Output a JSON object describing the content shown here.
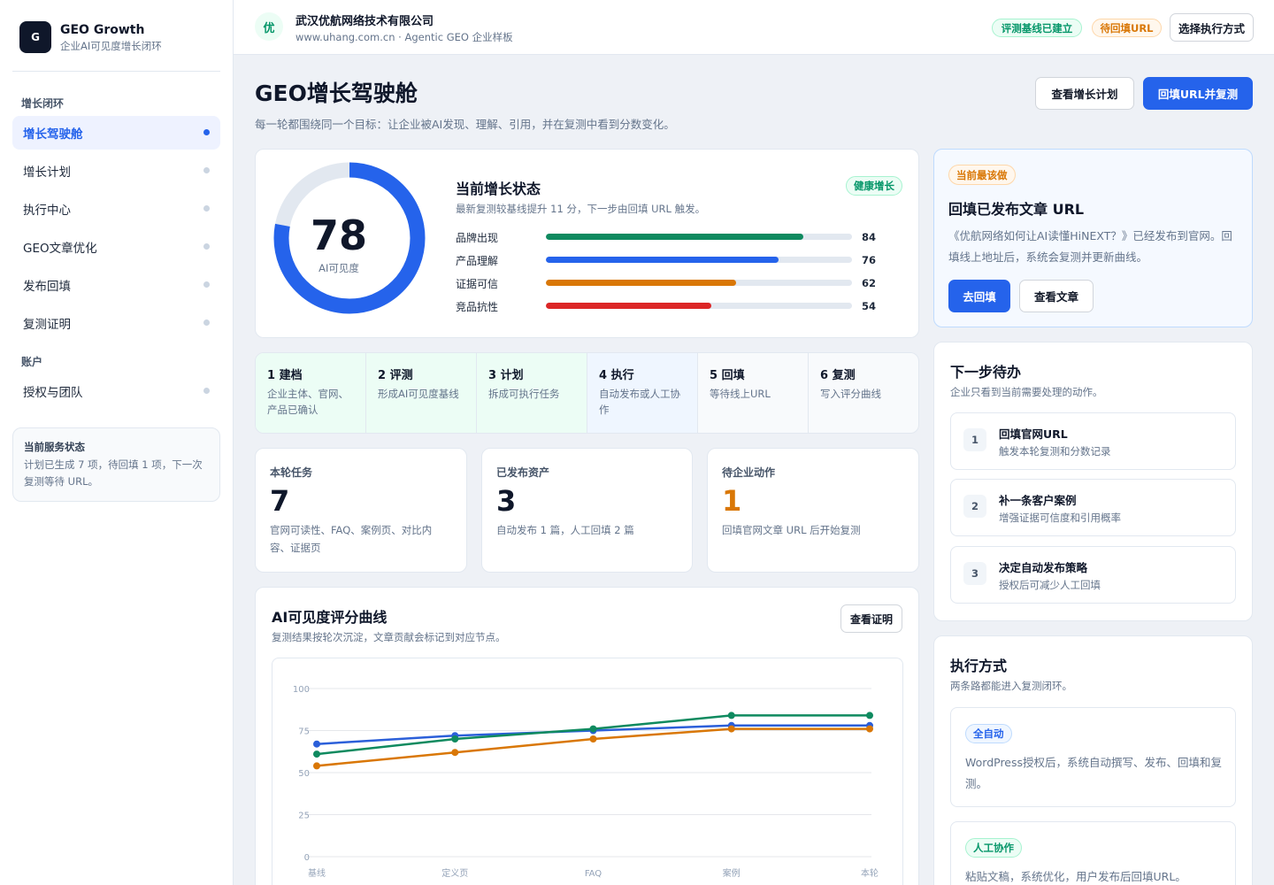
{
  "sidebar": {
    "brand": {
      "logo": "G",
      "title": "GEO Growth",
      "subtitle": "企业AI可见度增长闭环"
    },
    "section_growth": "增长闭环",
    "items": [
      {
        "label": "增长驾驶舱"
      },
      {
        "label": "增长计划"
      },
      {
        "label": "执行中心"
      },
      {
        "label": "GEO文章优化"
      },
      {
        "label": "发布回填"
      },
      {
        "label": "复测证明"
      }
    ],
    "section_account": "账户",
    "account_items": [
      {
        "label": "授权与团队"
      }
    ],
    "service": {
      "title": "当前服务状态",
      "desc": "计划已生成 7 项，待回填 1 项，下一次复测等待 URL。"
    }
  },
  "topbar": {
    "company_logo": "优",
    "company_name": "武汉优航网络技术有限公司",
    "company_sub": "www.uhang.com.cn · Agentic GEO 企业样板",
    "badge_baseline": "评测基线已建立",
    "badge_pending": "待回填URL",
    "choose_mode": "选择执行方式"
  },
  "header": {
    "title": "GEO增长驾驶舱",
    "desc": "每一轮都围绕同一个目标：让企业被AI发现、理解、引用，并在复测中看到分数变化。",
    "btn_plan": "查看增长计划",
    "btn_backfill": "回填URL并复测"
  },
  "status": {
    "score": "78",
    "score_value": 78,
    "score_label": "AI可见度",
    "title": "当前增长状态",
    "subtitle": "最新复测较基线提升 11 分，下一步由回填 URL 触发。",
    "health": "健康增长",
    "metrics": [
      {
        "label": "品牌出现",
        "value": "84",
        "color": "#0f8a5f"
      },
      {
        "label": "产品理解",
        "value": "76",
        "color": "#2563eb"
      },
      {
        "label": "证据可信",
        "value": "62",
        "color": "#d97706"
      },
      {
        "label": "竞品抗性",
        "value": "54",
        "color": "#dc2626"
      }
    ]
  },
  "steps": [
    {
      "title": "1 建档",
      "desc": "企业主体、官网、产品已确认"
    },
    {
      "title": "2 评测",
      "desc": "形成AI可见度基线"
    },
    {
      "title": "3 计划",
      "desc": "拆成可执行任务"
    },
    {
      "title": "4 执行",
      "desc": "自动发布或人工协作"
    },
    {
      "title": "5 回填",
      "desc": "等待线上URL"
    },
    {
      "title": "6 复测",
      "desc": "写入评分曲线"
    }
  ],
  "stats": [
    {
      "label": "本轮任务",
      "value": "7",
      "desc": "官网可读性、FAQ、案例页、对比内容、证据页",
      "color": "#0f172a"
    },
    {
      "label": "已发布资产",
      "value": "3",
      "desc": "自动发布 1 篇，人工回填 2 篇",
      "color": "#0f172a"
    },
    {
      "label": "待企业动作",
      "value": "1",
      "desc": "回填官网文章 URL 后开始复测",
      "color": "#d97706"
    }
  ],
  "chart_card": {
    "title": "AI可见度评分曲线",
    "subtitle": "复测结果按轮次沉淀，文章贡献会标记到对应节点。",
    "btn_proof": "查看证明"
  },
  "chart_data": {
    "type": "line",
    "categories": [
      "基线",
      "定义页",
      "FAQ",
      "案例",
      "本轮"
    ],
    "ylim": [
      0,
      100
    ],
    "yticks": [
      "0",
      "25",
      "50",
      "75",
      "100"
    ],
    "grid": true,
    "series": [
      {
        "values": [
          67,
          72,
          75,
          78,
          78
        ],
        "color": "#2b5fd9"
      },
      {
        "values": [
          61,
          70,
          76,
          84,
          84
        ],
        "color": "#0f8a5f"
      },
      {
        "values": [
          54,
          62,
          70,
          76,
          76
        ],
        "color": "#d97706"
      }
    ]
  },
  "next_todo": {
    "tag": "当前最该做",
    "title": "回填已发布文章 URL",
    "desc": "《优航网络如何让AI读懂HiNEXT？》已经发布到官网。回填线上地址后，系统会复测并更新曲线。",
    "btn_go": "去回填",
    "btn_view": "查看文章"
  },
  "next_steps": {
    "title": "下一步待办",
    "subtitle": "企业只看到当前需要处理的动作。",
    "tasks": [
      {
        "num": "1",
        "title": "回填官网URL",
        "desc": "触发本轮复测和分数记录"
      },
      {
        "num": "2",
        "title": "补一条客户案例",
        "desc": "增强证据可信度和引用概率"
      },
      {
        "num": "3",
        "title": "决定自动发布策略",
        "desc": "授权后可减少人工回填"
      }
    ]
  },
  "exec_mode": {
    "title": "执行方式",
    "subtitle": "两条路都能进入复测闭环。",
    "modes": [
      {
        "tag": "全自动",
        "desc": "WordPress授权后，系统自动撰写、发布、回填和复测。"
      },
      {
        "tag": "人工协作",
        "desc": "粘贴文稿，系统优化，用户发布后回填URL。"
      }
    ]
  }
}
